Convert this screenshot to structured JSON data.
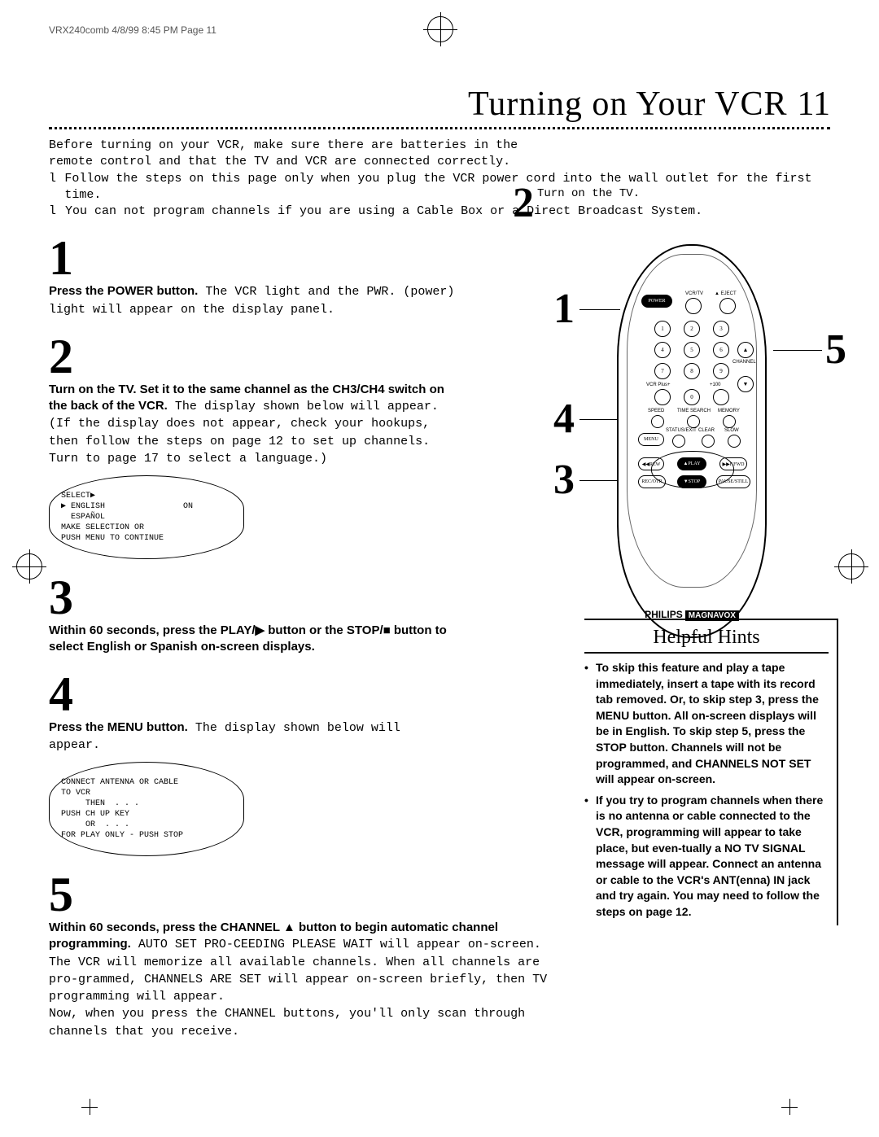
{
  "print_header": "VRX240comb  4/8/99 8:45 PM  Page 11",
  "title": "Turning on Your VCR",
  "page_number": "11",
  "intro_line1": "Before turning on your VCR, make sure there are batteries in the",
  "intro_line2": "remote control and that the TV and VCR are connected correctly.",
  "intro_bullet1": "Follow the steps on this page only when you plug the VCR power cord into the wall outlet for the first time.",
  "intro_bullet2": "You can not program channels if you are using a Cable Box or a Direct Broadcast System.",
  "steps": {
    "s1": {
      "num": "1",
      "bold": "Press the POWER button.",
      "rest": " The VCR light and the PWR. (power) light will appear on the display panel."
    },
    "s2": {
      "num": "2",
      "bold": "Turn on the TV. Set it to the same channel as the CH3/CH4 switch on the back of the VCR.",
      "rest": " The display shown below will appear. (If the display does not appear, check your hookups, then follow the steps on page 12 to set up channels. Turn to page 17 to select a language.)"
    },
    "s3": {
      "num": "3",
      "bold": "Within 60 seconds, press the PLAY/▶ button or the STOP/■ button to select English or Spanish on-screen displays.",
      "rest": ""
    },
    "s4": {
      "num": "4",
      "bold": "Press the MENU button.",
      "rest": " The display shown below will appear."
    },
    "s5": {
      "num": "5",
      "bold": "Within 60 seconds, press the CHANNEL ▲ button to begin automatic channel programming.",
      "rest": " AUTO SET PRO-CEEDING PLEASE WAIT will appear on-screen. The VCR will memorize all available channels. When all channels are pro-grammed, CHANNELS ARE SET will appear on-screen briefly, then TV programming will appear.\nNow, when you press the CHANNEL buttons, you'll only scan through channels that you receive."
    }
  },
  "osd1": {
    "l1": "SELECT▶",
    "l2": "▶ ENGLISH                ON",
    "l3": "  ESPAÑOL",
    "l4": "",
    "l5": "MAKE SELECTION OR",
    "l6": "PUSH MENU TO CONTINUE"
  },
  "osd2": {
    "l1": "CONNECT ANTENNA OR CABLE",
    "l2": "TO VCR",
    "l3": "",
    "l4": "     THEN  . . .",
    "l5": "PUSH CH UP KEY",
    "l6": "",
    "l7": "     OR  . . .",
    "l8": "FOR PLAY ONLY - PUSH STOP"
  },
  "remote_labels": {
    "power": "POWER",
    "vcrtv": "VCR/TV",
    "eject": "▲ EJECT",
    "n1": "1",
    "n2": "2",
    "n3": "3",
    "n4": "4",
    "n5": "5",
    "n6": "6",
    "n7": "7",
    "n8": "8",
    "n9": "9",
    "n0": "0",
    "vcrplus": "VCR Plus+",
    "plus100": "+100",
    "channel": "CHANNEL",
    "speed": "SPEED",
    "timesearch": "TIME SEARCH",
    "memory": "MEMORY",
    "menu": "MENU",
    "statusexit": "STATUS/EXIT",
    "clear": "CLEAR",
    "slow": "SLOW",
    "rew": "◀◀REW",
    "play": "▲PLAY",
    "ffwd": "▶▶F.FWD",
    "recotr": "REC/OTR",
    "stop": "▼STOP",
    "pause": "PAUSE/STILL"
  },
  "brand": {
    "philips": "PHILIPS",
    "magnavox": "MAGNAVOX"
  },
  "callouts": {
    "c1": "1",
    "c2": "2",
    "c3": "3",
    "c4": "4",
    "c5": "5"
  },
  "hints": {
    "title": "Helpful Hints",
    "h1": "To skip this feature and play a tape immediately, insert a tape with its record tab removed. Or, to skip step 3, press the MENU button. All on-screen displays will be in English. To skip step 5, press the STOP button. Channels will not be programmed, and CHANNELS NOT SET will appear on-screen.",
    "h2": "If you try to program channels when there is no antenna or cable connected to the VCR, programming will appear to take place, but even-tually a NO TV SIGNAL message will appear. Connect an antenna or cable to the VCR's ANT(enna) IN jack and try again. You may need to follow the steps on page 12."
  }
}
